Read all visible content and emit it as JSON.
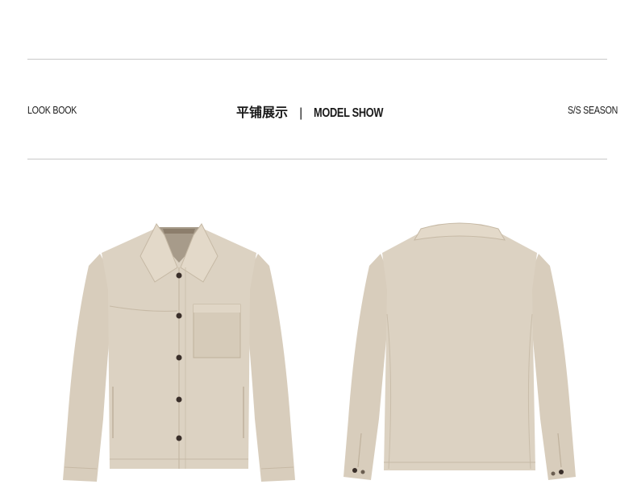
{
  "header": {
    "left_label": "LOOK BOOK",
    "title_cn": "平铺展示",
    "separator": "|",
    "title_en": "MODEL SHOW",
    "right_label": "S/S SEASON"
  },
  "colors": {
    "fabric": "#dcd2c2",
    "fabric_shadow": "#c9bdaa",
    "fabric_highlight": "#e6ddcf",
    "button": "#3a2f2a",
    "rule": "#c9c9c9"
  }
}
